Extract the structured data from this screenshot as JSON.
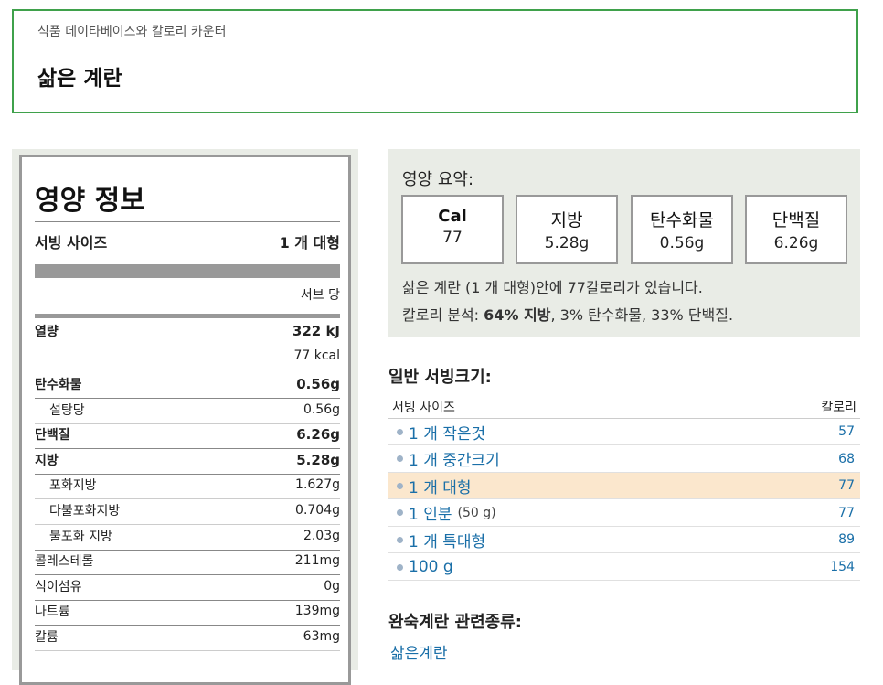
{
  "breadcrumb": "식품 데이타베이스와 칼로리 카운터",
  "title": "삶은 계란",
  "label": {
    "heading": "영양 정보",
    "serving_size_label": "서빙 사이즈",
    "serving_size_value": "1 개 대형",
    "per_serving": "서브 당",
    "energy_label": "열량",
    "energy_kj": "322 kJ",
    "energy_kcal": "77 kcal",
    "nutrients": [
      {
        "label": "탄수화물",
        "value": "0.56g",
        "bold": true
      },
      {
        "label": "설탕당",
        "value": "0.56g",
        "bold": false
      },
      {
        "label": "단백질",
        "value": "6.26g",
        "bold": true
      },
      {
        "label": "지방",
        "value": "5.28g",
        "bold": true
      },
      {
        "label": "포화지방",
        "value": "1.627g",
        "bold": false
      },
      {
        "label": "다불포화지방",
        "value": "0.704g",
        "bold": false
      },
      {
        "label": "불포화 지방",
        "value": "2.03g",
        "bold": false
      },
      {
        "label": "콜레스테롤",
        "value": "211mg",
        "bold": false
      },
      {
        "label": "식이섬유",
        "value": "0g",
        "bold": false
      },
      {
        "label": "나트륨",
        "value": "139mg",
        "bold": false
      },
      {
        "label": "칼륨",
        "value": "63mg",
        "bold": false
      }
    ]
  },
  "summary": {
    "title": "영양 요약:",
    "stats": [
      {
        "label": "Cal",
        "value": "77"
      },
      {
        "label": "지방",
        "value": "5.28g"
      },
      {
        "label": "탄수화물",
        "value": "0.56g"
      },
      {
        "label": "단백질",
        "value": "6.26g"
      }
    ],
    "line1": "삶은 계란 (1 개 대형)안에 77칼로리가 있습니다.",
    "line2_prefix": "칼로리 분석: ",
    "line2_bold": "64% 지방",
    "line2_rest": ", 3% 탄수화물, 33% 단백질."
  },
  "servings": {
    "title": "일반 서빙크기:",
    "col_size": "서빙 사이즈",
    "col_cal": "칼로리",
    "rows": [
      {
        "size": "1 개 작은것",
        "note": "",
        "cal": "57"
      },
      {
        "size": "1 개 중간크기",
        "note": "",
        "cal": "68"
      },
      {
        "size": "1 개 대형",
        "note": "",
        "cal": "77"
      },
      {
        "size": "1 인분",
        "note": "(50 g)",
        "cal": "77"
      },
      {
        "size": "1 개 특대형",
        "note": "",
        "cal": "89"
      },
      {
        "size": "100 g",
        "note": "",
        "cal": "154"
      }
    ]
  },
  "related": {
    "title": "완숙계란 관련종류:",
    "link": "삶은계란"
  }
}
